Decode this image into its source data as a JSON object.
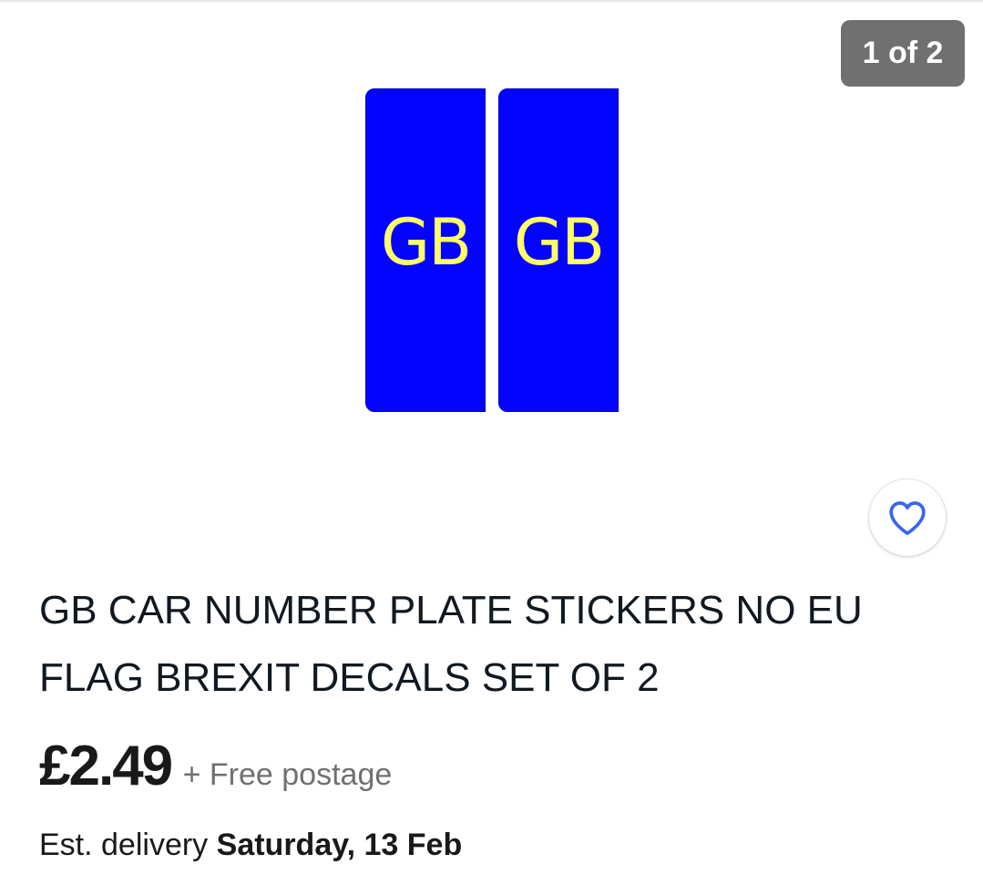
{
  "gallery": {
    "counter": "1 of 2",
    "image": {
      "plate_left_text": "GB",
      "plate_right_text": "GB",
      "plate_color": "#0303ff",
      "text_color": "#ffff66"
    }
  },
  "watch": {
    "icon": "heart-outline-icon",
    "color": "#3665f3"
  },
  "product": {
    "title": "GB CAR NUMBER PLATE STICKERS NO EU FLAG BREXIT DECALS SET OF 2",
    "price": "£2.49",
    "postage": "+ Free postage",
    "delivery_label": "Est. delivery",
    "delivery_date": "Saturday, 13 Feb"
  }
}
